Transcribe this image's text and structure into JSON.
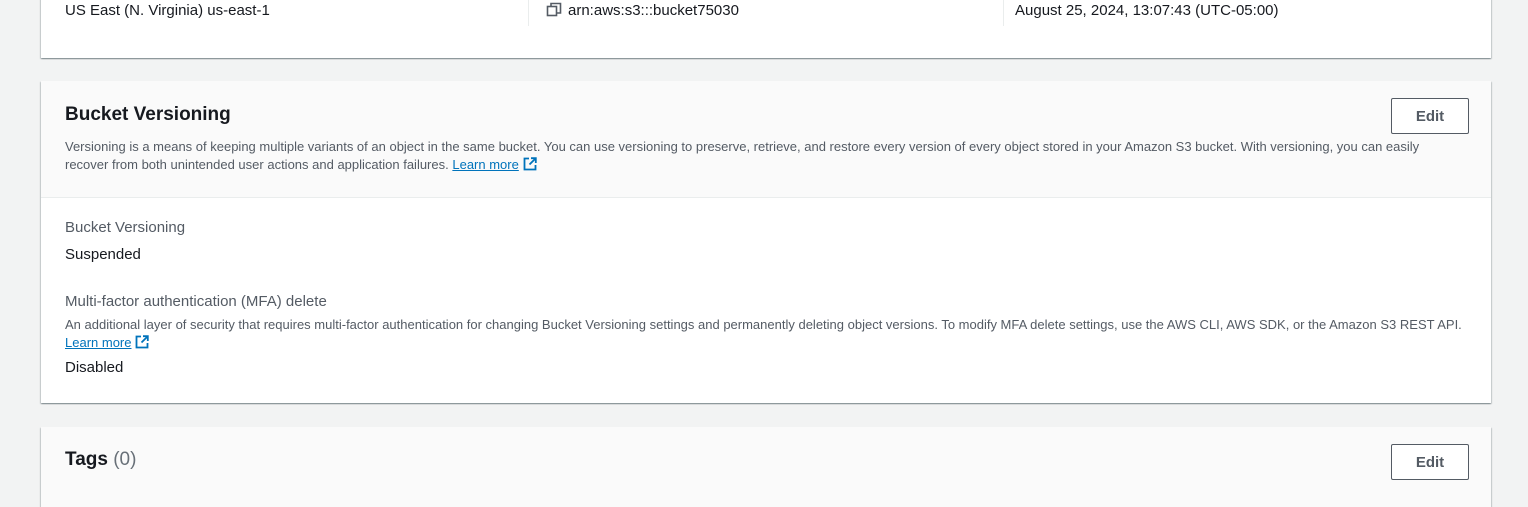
{
  "overview": {
    "region": "US East (N. Virginia) us-east-1",
    "arn": "arn:aws:s3:::bucket75030",
    "creation_date": "August 25, 2024, 13:07:43 (UTC-05:00)"
  },
  "versioning": {
    "title": "Bucket Versioning",
    "edit_label": "Edit",
    "description": "Versioning is a means of keeping multiple variants of an object in the same bucket. You can use versioning to preserve, retrieve, and restore every version of every object stored in your Amazon S3 bucket. With versioning, you can easily recover from both unintended user actions and application failures.",
    "learn_more": "Learn more",
    "status_label": "Bucket Versioning",
    "status_value": "Suspended",
    "mfa_label": "Multi-factor authentication (MFA) delete",
    "mfa_description": "An additional layer of security that requires multi-factor authentication for changing Bucket Versioning settings and permanently deleting object versions. To modify MFA delete settings, use the AWS CLI, AWS SDK, or the Amazon S3 REST API.",
    "mfa_learn_more": "Learn more",
    "mfa_value": "Disabled"
  },
  "tags": {
    "title": "Tags",
    "count": "(0)",
    "edit_label": "Edit"
  },
  "colors": {
    "link": "#0073bb",
    "background": "#f2f3f3",
    "secondary_text": "#545b64"
  },
  "icons": {
    "copy": "copy-icon",
    "external_link": "external-link-icon"
  }
}
